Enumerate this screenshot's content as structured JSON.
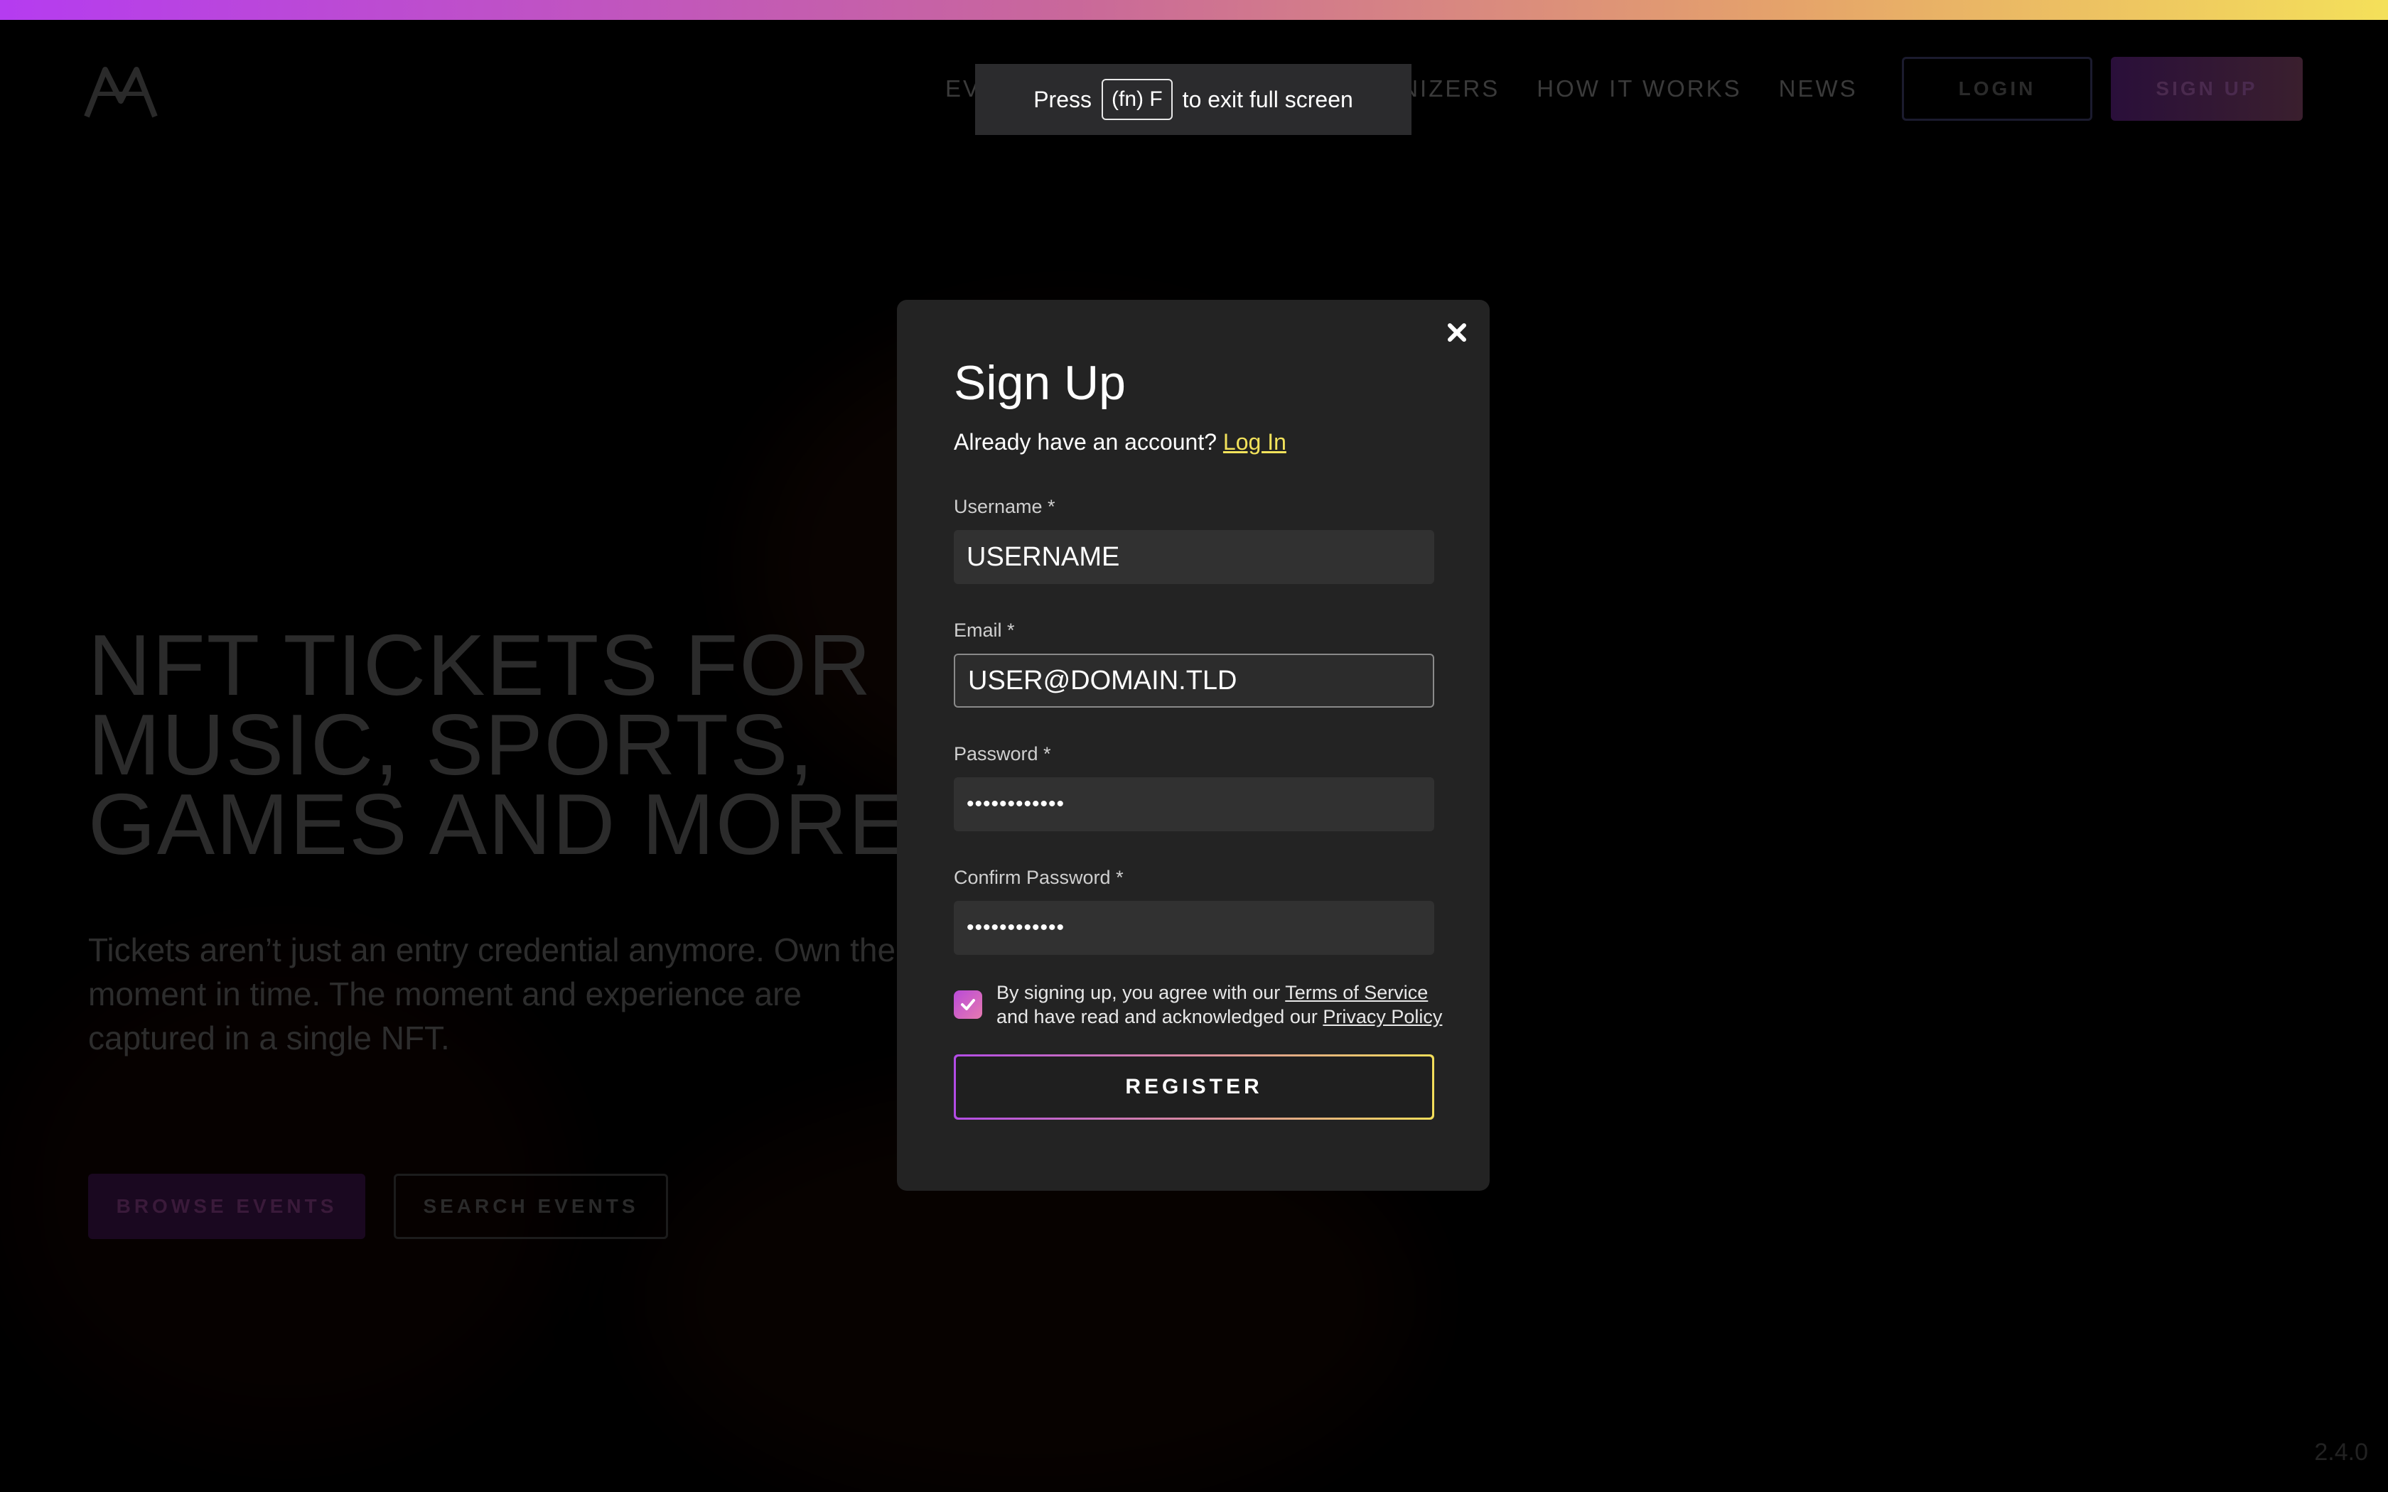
{
  "header": {
    "nav": [
      "EVENTS",
      "ORGANIZERS",
      "HOW IT WORKS",
      "NEWS"
    ],
    "login_label": "LOGIN",
    "signup_label": "SIGN UP"
  },
  "fullscreen_notice": {
    "prefix": "Press",
    "key": "(fn) F",
    "suffix": "to exit full screen"
  },
  "hero": {
    "title_lines": [
      "NFT TICKETS FOR",
      "MUSIC, SPORTS,",
      "GAMES AND MORE."
    ],
    "subtitle": "Tickets aren’t just an entry credential anymore. Own the moment in time. The moment and experience are captured in a single NFT.",
    "browse_label": "BROWSE EVENTS",
    "search_label": "SEARCH EVENTS"
  },
  "version": "2.4.0",
  "modal": {
    "title": "Sign Up",
    "login_prompt": "Already have an account?",
    "login_link": "Log In",
    "fields": {
      "username": {
        "label": "Username *",
        "value": "USERNAME"
      },
      "email": {
        "label": "Email *",
        "value": "USER@DOMAIN.TLD"
      },
      "password": {
        "label": "Password *",
        "value": "••••••••••••"
      },
      "confirm": {
        "label": "Confirm Password *",
        "value": "••••••••••••"
      }
    },
    "terms": {
      "text1": "By signing up, you agree with our",
      "tos": "Terms of Service",
      "text2": "and have read and acknowledged our",
      "privacy": "Privacy Policy",
      "checked": true
    },
    "register_label": "REGISTER"
  },
  "colors": {
    "accent_yellow": "#f2e25b",
    "accent_purple": "#b34ce6",
    "modal_bg": "#232323"
  }
}
